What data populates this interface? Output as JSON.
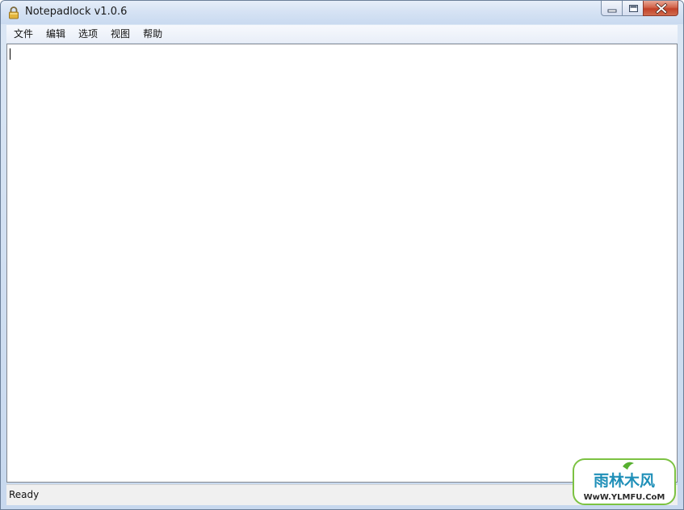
{
  "window": {
    "title": "Notepadlock v1.0.6",
    "icon": "padlock-icon"
  },
  "caption_buttons": {
    "minimize": "minimize-icon",
    "maximize": "maximize-icon",
    "close": "close-icon"
  },
  "menubar": {
    "items": [
      {
        "label": "文件"
      },
      {
        "label": "编辑"
      },
      {
        "label": "选项"
      },
      {
        "label": "视图"
      },
      {
        "label": "帮助"
      }
    ]
  },
  "editor": {
    "value": ""
  },
  "statusbar": {
    "text": "Ready"
  },
  "watermark": {
    "brand": "雨林木风",
    "url": "WwW.YLMFU.CoM"
  },
  "colors": {
    "titlebar": "#d6e3f4",
    "close_button": "#c24128",
    "statusbar": "#f0f0f0"
  }
}
